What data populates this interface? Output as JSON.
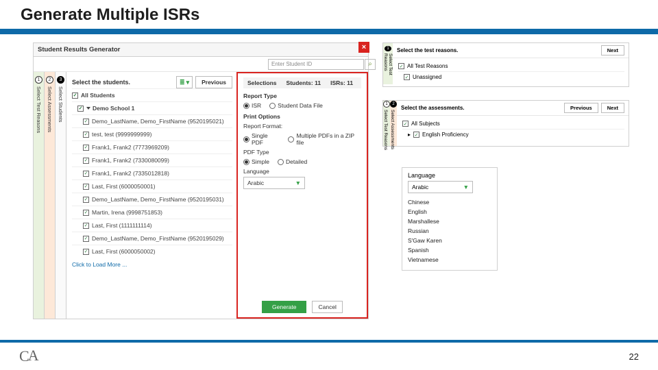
{
  "title": "Generate Multiple ISRs",
  "page_number": "22",
  "logo_text": "CA",
  "generator": {
    "header": "Student Results Generator",
    "search_placeholder": "Enter Student ID",
    "step_tabs": [
      {
        "num": "1",
        "label": "Select Test Reasons"
      },
      {
        "num": "2",
        "label": "Select Assessments"
      },
      {
        "num": "3",
        "label": "Select Students"
      }
    ],
    "step3_title": "Select the students.",
    "previous_btn": "Previous",
    "all_students_label": "All Students",
    "school_label": "Demo School 1",
    "students": [
      "Demo_LastName, Demo_FirstName (9520195021)",
      "test, test (9999999999)",
      "Frank1, Frank2 (7773969209)",
      "Frank1, Frank2 (7330080099)",
      "Frank1, Frank2 (7335012818)",
      "Last, First (6000050001)",
      "Demo_LastName, Demo_FirstName (9520195031)",
      "Martin, Irena (9998751853)",
      "Last, First (1111111114)",
      "Demo_LastName, Demo_FirstName (9520195029)",
      "Last, First (6000050002)"
    ],
    "load_more": "Click to Load More ...",
    "selections": {
      "head_label": "Selections",
      "students_count": "Students: 11",
      "isrs_count": "ISRs: 11",
      "report_type_label": "Report Type",
      "isr_radio": "ISR",
      "sdf_radio": "Student Data File",
      "print_options_label": "Print Options",
      "report_format_label": "Report Format:",
      "single_pdf": "Single PDF",
      "multi_pdf": "Multiple PDFs in a ZIP file",
      "pdf_type_label": "PDF Type",
      "simple": "Simple",
      "detailed": "Detailed",
      "language_label": "Language",
      "language_value": "Arabic",
      "generate_btn": "Generate",
      "cancel_btn": "Cancel"
    }
  },
  "step1_panel": {
    "title": "Select the test reasons.",
    "next_btn": "Next",
    "all": "All Test Reasons",
    "unassigned": "Unassigned"
  },
  "step2_panel": {
    "title": "Select the assessments.",
    "previous_btn": "Previous",
    "next_btn": "Next",
    "all": "All Subjects",
    "elp": "English Proficiency"
  },
  "language_box": {
    "label": "Language",
    "value": "Arabic",
    "options": [
      "Chinese",
      "English",
      "Marshallese",
      "Russian",
      "S'Gaw Karen",
      "Spanish",
      "Vietnamese"
    ]
  }
}
